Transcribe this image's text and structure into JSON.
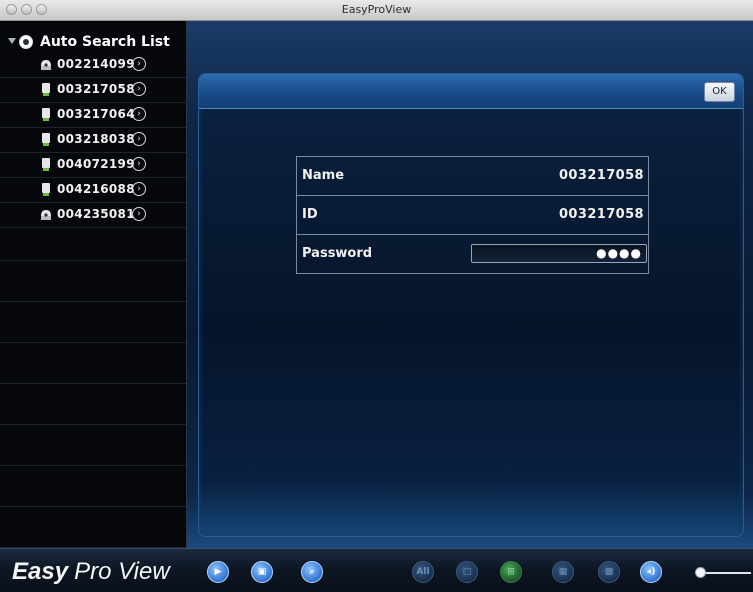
{
  "window": {
    "title": "EasyProView"
  },
  "sidebar": {
    "header": "Auto Search List",
    "devices": [
      {
        "id": "002214099",
        "icon": "camera-dome-icon"
      },
      {
        "id": "003217058",
        "icon": "camera-bullet-icon"
      },
      {
        "id": "003217064",
        "icon": "camera-bullet-icon"
      },
      {
        "id": "003218038",
        "icon": "camera-bullet-icon"
      },
      {
        "id": "004072199",
        "icon": "camera-bullet-icon"
      },
      {
        "id": "004216088",
        "icon": "camera-bullet-icon"
      },
      {
        "id": "004235081",
        "icon": "camera-dome-icon"
      }
    ]
  },
  "dialog": {
    "ok_label": "OK",
    "fields": {
      "name_label": "Name",
      "name_value": "003217058",
      "id_label": "ID",
      "id_value": "003217058",
      "password_label": "Password",
      "password_value": "●●●●"
    }
  },
  "toolbar": {
    "logo_bold": "Easy",
    "logo_light": "Pro View",
    "all_label": "All"
  },
  "colors": {
    "accent": "#2e6bb0",
    "background": "#0b0f17"
  }
}
